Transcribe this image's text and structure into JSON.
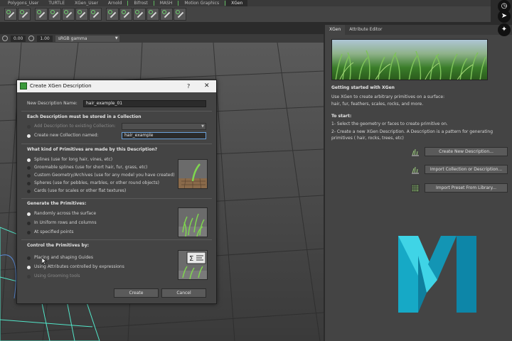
{
  "shelf": {
    "tabs": [
      "Polygons_User",
      "TURTLE",
      "XGen_User",
      "Arnold",
      "Bifrost",
      "MASH",
      "Motion Graphics",
      "XGen"
    ],
    "active_tab": "XGen"
  },
  "viewport_toolbar": {
    "exposure": "0.00",
    "gamma": "1.00",
    "color_space": "sRGB gamma"
  },
  "right_panel": {
    "tabs": [
      "XGen",
      "Attribute Editor"
    ],
    "heading": "Getting started with XGen",
    "intro_line1": "Use XGen to create arbitrary primitives on a surface:",
    "intro_line2": "hair, fur, feathers, scales, rocks, and more.",
    "to_start": "To start:",
    "step1": "1- Select the geometry or faces to create primitive on.",
    "step2_line1": "2- Create a new XGen Description. A Description is a pattern for generating",
    "step2_line2": "primitives ( hair, rocks, trees, etc)",
    "buttons": [
      "Create New Description...",
      "Import Collection or Description...",
      "Import Preset From Library..."
    ]
  },
  "dialog": {
    "title": "Create XGen Description",
    "help": "?",
    "close": "✕",
    "name_label": "New Description Name:",
    "name_value": "hair_example_01",
    "collection_heading": "Each Description must be stored in a Collection",
    "add_existing": "Add Description to existing Collection:",
    "create_new": "Create new Collection named:",
    "collection_value": "hair_example",
    "primitives_heading": "What kind of Primitives are made by this Description?",
    "primitive_options": [
      "Splines (use for long hair, vines, etc)",
      "Groomable splines (use for short hair, fur, grass, etc)",
      "Custom Geometry/Archives (use for any model you have created)",
      "Spheres (use for pebbles, marbles, or other round objects)",
      "Cards (use for scales or other flat textures)"
    ],
    "generate_heading": "Generate the Primitives:",
    "generate_options": [
      "Randomly across the surface",
      "In Uniform rows and columns",
      "At specified points"
    ],
    "control_heading": "Control the Primitives by:",
    "control_options": [
      "Placing and shaping Guides",
      "Using Attributes controlled by expressions",
      "Using Grooming tools"
    ],
    "create_button": "Create",
    "cancel_button": "Cancel"
  }
}
